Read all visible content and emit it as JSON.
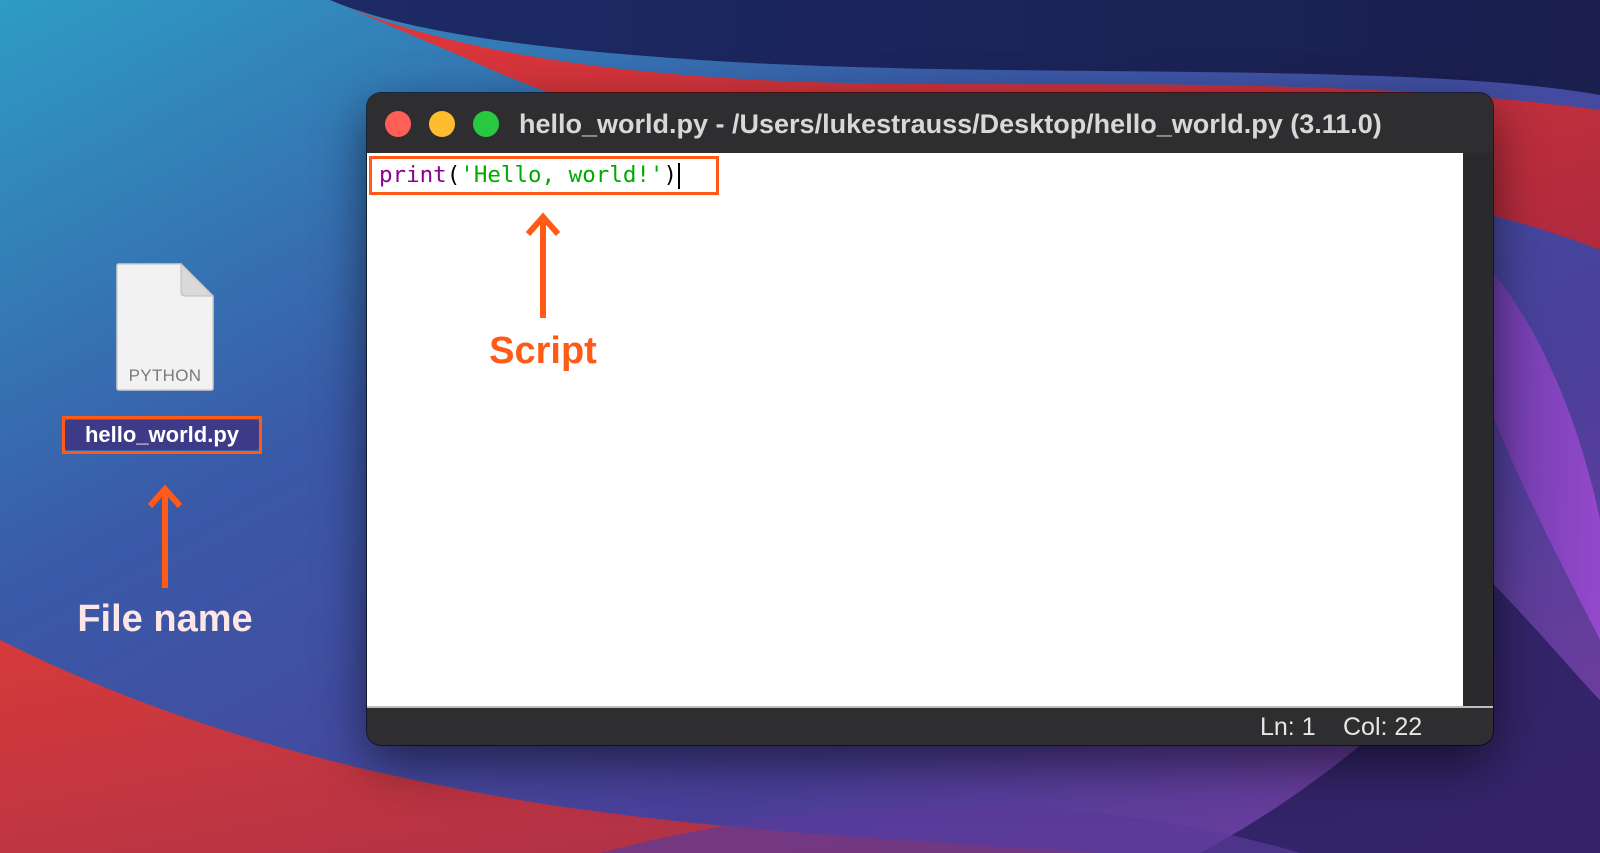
{
  "desktop": {
    "file": {
      "type_label": "PYTHON",
      "name": "hello_world.py"
    }
  },
  "annotations": {
    "file_name": "File name",
    "script": "Script"
  },
  "window": {
    "title": "hello_world.py - /Users/lukestrauss/Desktop/hello_world.py (3.11.0)",
    "code": {
      "builtin": "print",
      "open_paren": "(",
      "string": "'Hello, world!'",
      "close_paren": ")"
    },
    "status": {
      "line": "Ln: 1",
      "column": "Col: 22"
    }
  },
  "colors": {
    "annotation": "#ff5a16",
    "builtin": "#900090",
    "string": "#00aa00",
    "close": "#ff5f57",
    "minimize": "#febc2e",
    "maximize": "#28c840"
  },
  "icons": [
    "close-icon",
    "minimize-icon",
    "maximize-icon",
    "python-file-icon",
    "arrow-up-icon"
  ]
}
